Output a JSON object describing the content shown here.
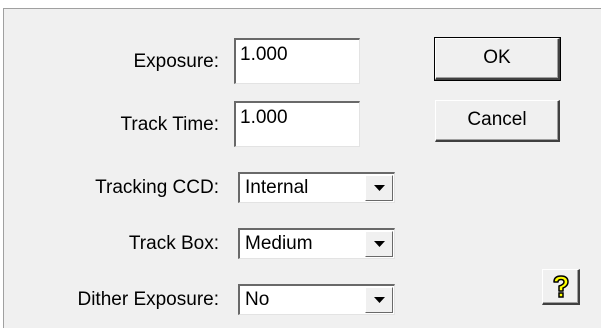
{
  "fields": {
    "exposure": {
      "label": "Exposure:",
      "value": "1.000"
    },
    "track_time": {
      "label": "Track Time:",
      "value": "1.000"
    },
    "tracking_ccd": {
      "label": "Tracking CCD:",
      "value": "Internal"
    },
    "track_box": {
      "label": "Track Box:",
      "value": "Medium"
    },
    "dither_exposure": {
      "label": "Dither Exposure:",
      "value": "No"
    }
  },
  "buttons": {
    "ok_label": "OK",
    "cancel_label": "Cancel"
  },
  "icons": {
    "dropdown": "chevron-down-icon",
    "help": "question-mark-icon"
  },
  "colors": {
    "dialog_bg": "#f0f0f0",
    "help_icon_fill": "#ffff00"
  }
}
